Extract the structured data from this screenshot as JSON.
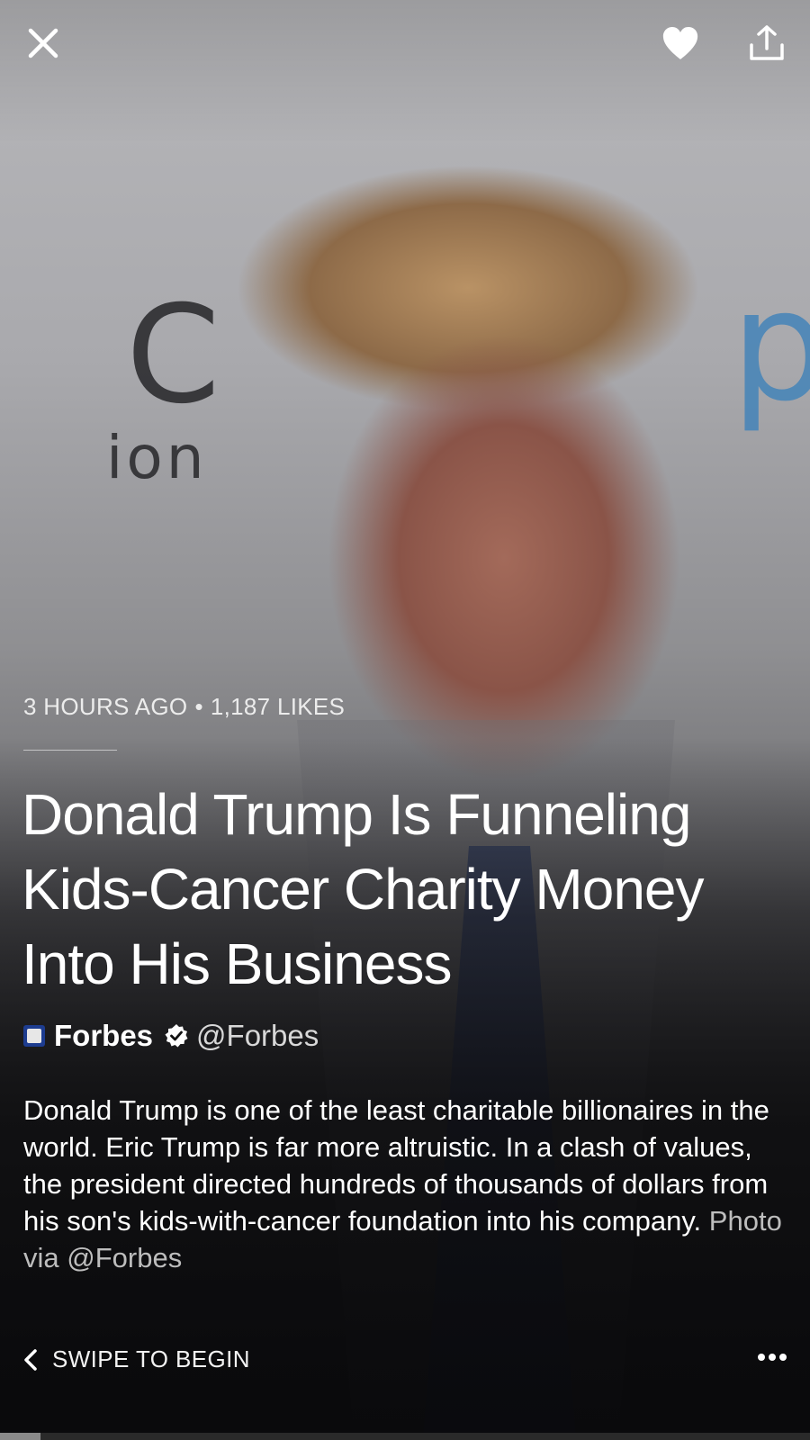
{
  "top_bar": {
    "close_icon": "close-icon",
    "like_icon": "heart-icon",
    "share_icon": "share-icon"
  },
  "article": {
    "time_ago": "3 HOURS AGO",
    "separator": "•",
    "likes": "1,187 LIKES",
    "headline": "Donald Trump Is Funneling Kids-Cancer Charity Money Into His Business",
    "source": {
      "name": "Forbes",
      "handle": "@Forbes",
      "verified_icon": "verified-badge-icon",
      "logo_icon": "forbes-logo-icon"
    },
    "description": "Donald Trump is one of the least charitable billionaires in the world. Eric Trump is far more altruistic. In a clash of values, the president directed hundreds of thousands of dollars from his son's kids-with-cancer foundation into his company.",
    "photo_credit": "Photo via @Forbes"
  },
  "footer": {
    "swipe_label": "SWIPE TO BEGIN",
    "chevron_icon": "chevron-left-icon",
    "more_icon": "more-icon"
  },
  "progress": {
    "fraction": 0.05
  },
  "colors": {
    "text_primary": "#ffffff",
    "text_secondary": "#bdbdbd",
    "forbes_blue": "#1d3c8f"
  }
}
